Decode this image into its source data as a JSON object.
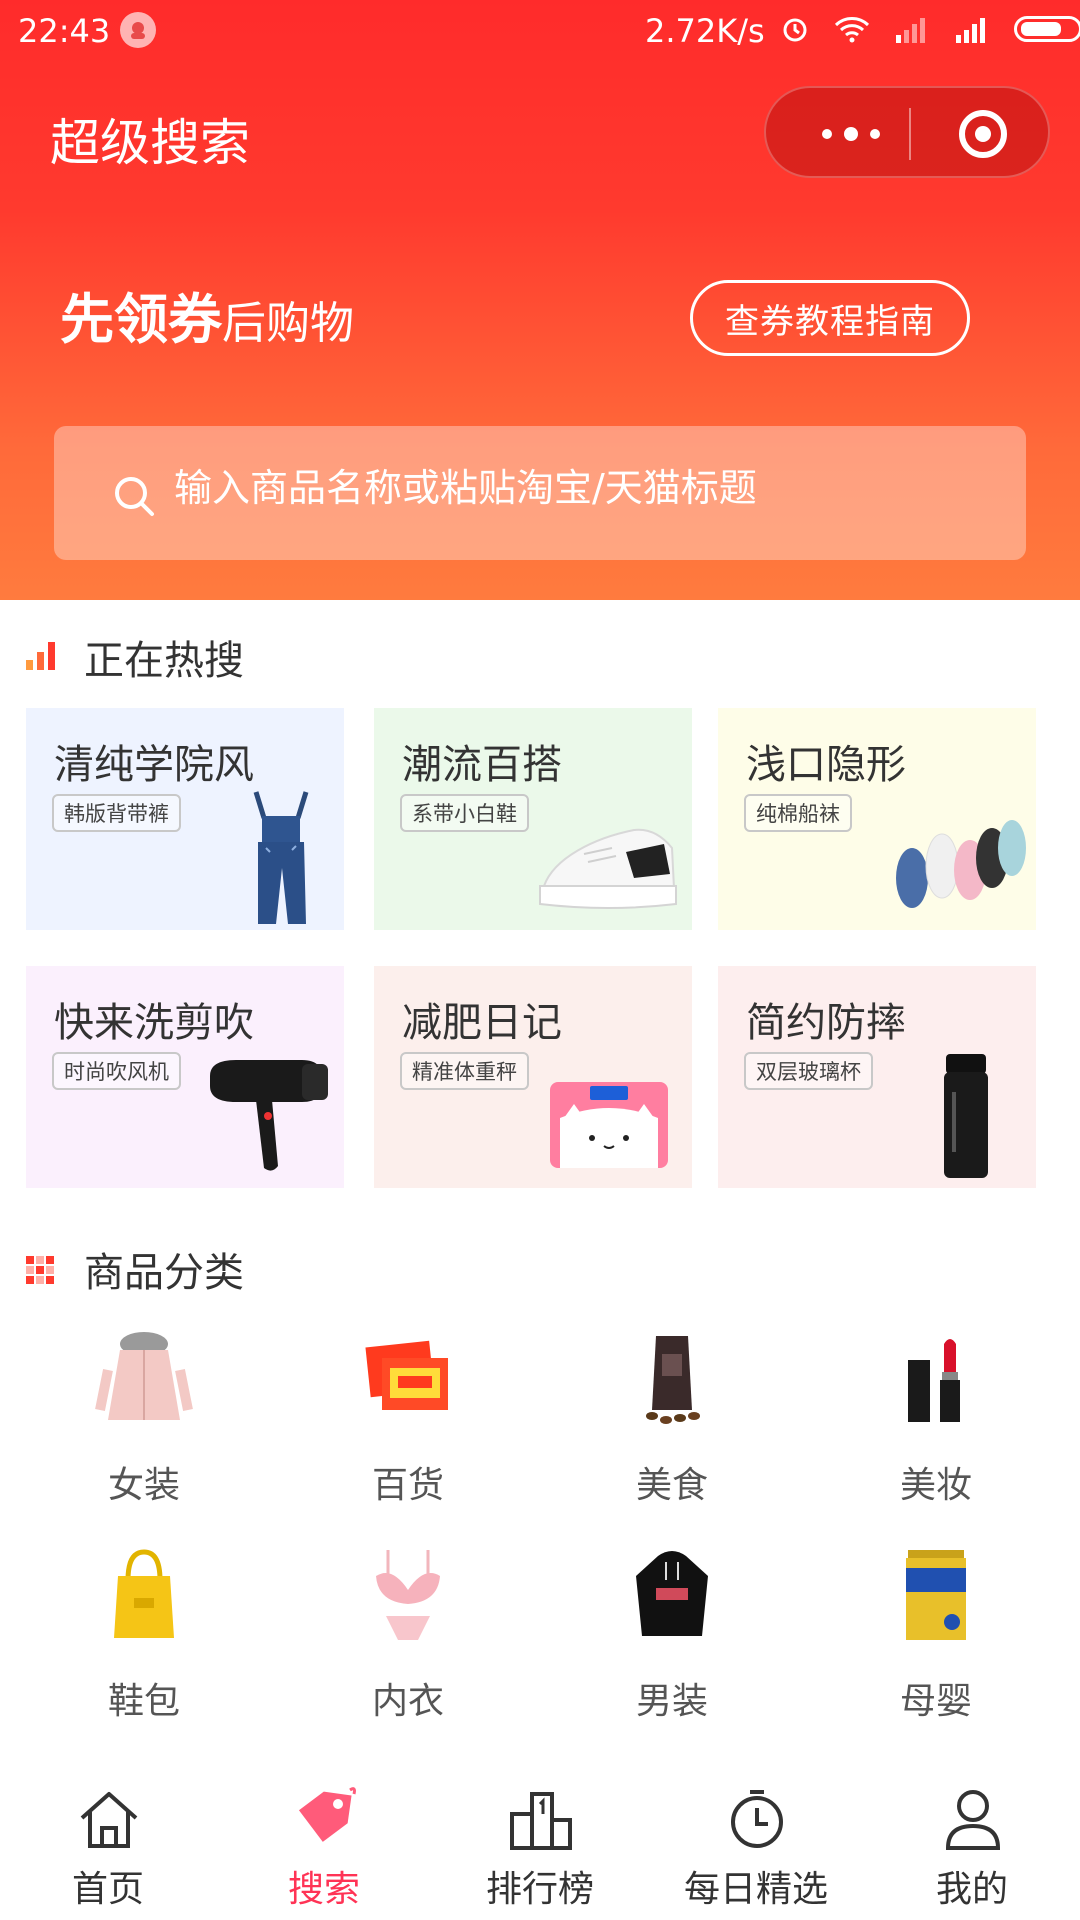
{
  "status_bar": {
    "time": "22:43",
    "network_speed": "2.72K/s"
  },
  "header": {
    "title": "超级搜索",
    "slogan_strong": "先领券",
    "slogan_rest": "后购物",
    "guide_button": "查券教程指南"
  },
  "search": {
    "placeholder": "输入商品名称或粘贴淘宝/天猫标题"
  },
  "hot_search": {
    "title": "正在热搜",
    "cards": [
      {
        "title": "清纯学院风",
        "tag": "韩版背带裤",
        "bg": "#eef3ff",
        "icon": "overalls-image"
      },
      {
        "title": "潮流百搭",
        "tag": "系带小白鞋",
        "bg": "#ebf9ea",
        "icon": "sneaker-image"
      },
      {
        "title": "浅口隐形",
        "tag": "纯棉船袜",
        "bg": "#fefde8",
        "icon": "socks-image"
      },
      {
        "title": "快来洗剪吹",
        "tag": "时尚吹风机",
        "bg": "#fbf0fd",
        "icon": "hair-dryer-image"
      },
      {
        "title": "减肥日记",
        "tag": "精准体重秤",
        "bg": "#fcefec",
        "icon": "scale-image"
      },
      {
        "title": "简约防摔",
        "tag": "双层玻璃杯",
        "bg": "#fdeeee",
        "icon": "glass-cup-image"
      }
    ]
  },
  "categories": {
    "title": "商品分类",
    "items": [
      {
        "label": "女装",
        "icon": "womens-coat-image"
      },
      {
        "label": "百货",
        "icon": "heat-pack-image"
      },
      {
        "label": "美食",
        "icon": "coffee-beans-image"
      },
      {
        "label": "美妆",
        "icon": "lipstick-image"
      },
      {
        "label": "鞋包",
        "icon": "tote-bag-image"
      },
      {
        "label": "内衣",
        "icon": "lingerie-image"
      },
      {
        "label": "男装",
        "icon": "hoodie-image"
      },
      {
        "label": "母婴",
        "icon": "milk-powder-image"
      }
    ]
  },
  "tabbar": {
    "items": [
      {
        "label": "首页",
        "icon": "home-icon",
        "active": false
      },
      {
        "label": "搜索",
        "icon": "tag-icon",
        "active": true
      },
      {
        "label": "排行榜",
        "icon": "podium-icon",
        "active": false
      },
      {
        "label": "每日精选",
        "icon": "alarm-clock-icon",
        "active": false
      },
      {
        "label": "我的",
        "icon": "user-icon",
        "active": false
      }
    ]
  },
  "colors": {
    "brand_red": "#ff2b2b",
    "brand_orange": "#ff7b3e",
    "active_tab": "#ff3355"
  }
}
